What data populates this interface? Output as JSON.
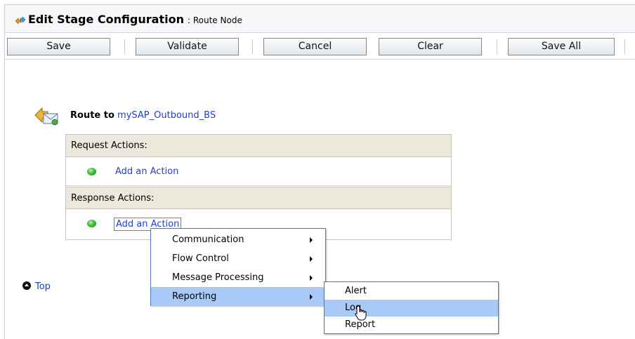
{
  "title_bar": {
    "title": "Edit Stage Configuration",
    "subtitle": ": Route Node",
    "icon": "stage-config-icon"
  },
  "toolbar": {
    "buttons": [
      {
        "label": "Save"
      },
      {
        "label": "Validate"
      },
      {
        "label": "Cancel"
      },
      {
        "label": "Clear"
      },
      {
        "label": "Save All"
      }
    ]
  },
  "route": {
    "label": "Route to",
    "target": "mySAP_Outbound_BS",
    "icon": "route-envelope-icon"
  },
  "request_section": {
    "header": "Request Actions:",
    "action_link": "Add an Action"
  },
  "response_section": {
    "header": "Response Actions:",
    "action_link": "Add an Action"
  },
  "top_link": "Top",
  "context_menu": {
    "items": [
      {
        "label": "Communication",
        "has_submenu": true
      },
      {
        "label": "Flow Control",
        "has_submenu": true
      },
      {
        "label": "Message Processing",
        "has_submenu": true
      },
      {
        "label": "Reporting",
        "has_submenu": true,
        "highlighted": true
      }
    ]
  },
  "submenu": {
    "items": [
      {
        "label": "Alert"
      },
      {
        "label": "Log",
        "highlighted": true
      },
      {
        "label": "Report"
      }
    ]
  },
  "colors": {
    "link": "#1b3fd4",
    "menu_highlight": "#a9c9f6",
    "section_header_bg": "#ece9dc",
    "menu_border": "#4d72c8"
  }
}
